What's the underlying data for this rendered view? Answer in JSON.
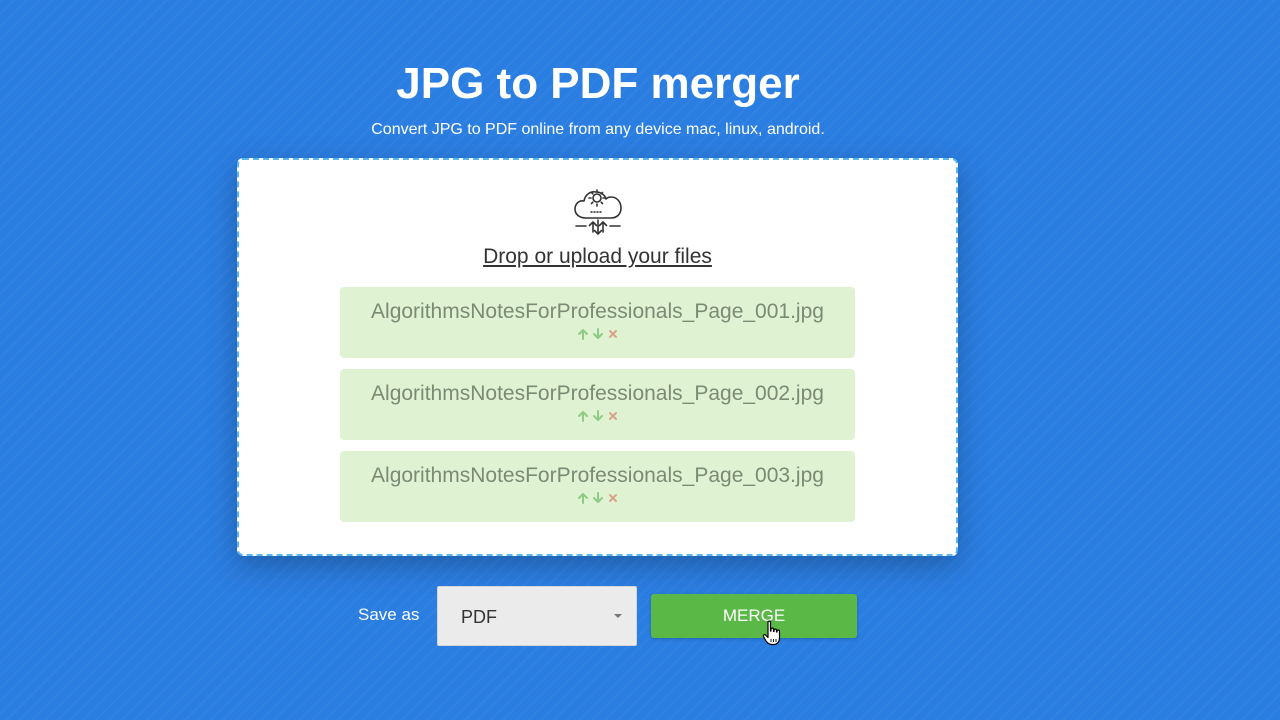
{
  "header": {
    "title": "JPG to PDF merger",
    "subtitle": "Convert JPG to PDF online from any device mac, linux, android."
  },
  "dropzone": {
    "icon": "cloud-gear-upload-icon",
    "upload_label": "Drop or upload your files",
    "files": [
      {
        "name": "AlgorithmsNotesForProfessionals_Page_001.jpg"
      },
      {
        "name": "AlgorithmsNotesForProfessionals_Page_002.jpg"
      },
      {
        "name": "AlgorithmsNotesForProfessionals_Page_003.jpg"
      }
    ],
    "file_controls": {
      "move_up_icon": "arrow-up-icon",
      "move_down_icon": "arrow-down-icon",
      "remove_icon": "close-icon"
    }
  },
  "controls": {
    "save_as_label": "Save as",
    "format_selected": "PDF",
    "merge_label": "MERGE"
  },
  "colors": {
    "background": "#2a7de1",
    "file_item_bg": "#dff3d3",
    "merge_button": "#5ab946",
    "dropzone_border": "#5bb8ee",
    "arrow_icons": "#8fcb84",
    "remove_icon": "#d9a58a"
  }
}
